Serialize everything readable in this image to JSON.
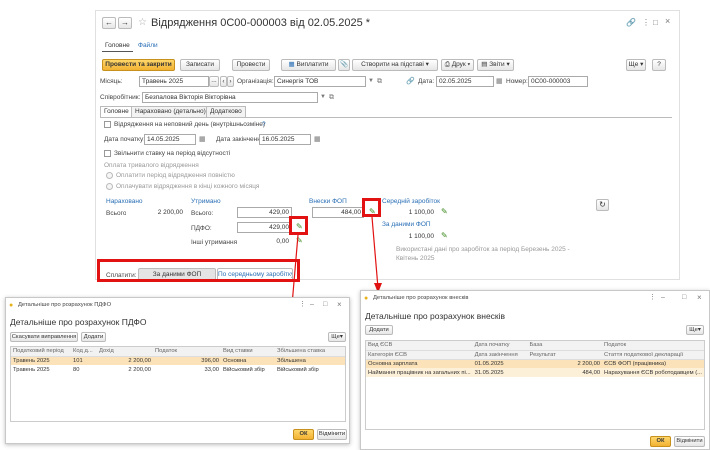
{
  "main": {
    "title": "Відрядження 0С00-000003 від 02.05.2025 *",
    "nav_tabs": [
      "Головне",
      "Файли"
    ],
    "toolbar": {
      "post_close": "Провести та закрити",
      "save": "Записати",
      "post": "Провести",
      "payments": "Виплатити",
      "create_based": "Створити на підставі",
      "print": "Друк",
      "reports": "Звіти",
      "more": "Ще",
      "help": "?"
    },
    "month_label": "Місяць:",
    "month_value": "Травень 2025",
    "org_label": "Організація:",
    "org_value": "Синергія ТОВ",
    "date_label": "Дата:",
    "date_value": "02.05.2025",
    "number_label": "Номер:",
    "number_value": "0С00-000003",
    "employee_label": "Співробітник:",
    "employee_value": "Безпалова Вікторія Вікторівна",
    "doc_tabs": [
      "Головне",
      "Нараховано (детально)",
      "Додатково"
    ],
    "partial_day": "Відрядження на неповний день (внутрішньозміне)",
    "partial_help": "?",
    "start_label": "Дата початку:",
    "start_value": "14.05.2025",
    "end_label": "Дата закінчення:",
    "end_value": "16.05.2025",
    "free_rate": "Звільнити ставку на період відсутності",
    "long_trip": "Оплата тривалого відрядження",
    "opt1": "Оплатити період відрядження повністю",
    "opt2": "Оплачувати відрядження в кінці кожного місяця",
    "accrued_h": "Нараховано",
    "withheld_h": "Утримано",
    "contrib_h": "Внески ФОП",
    "avg_h": "Середній заробіток",
    "total_label1": "Всього:",
    "total_accrued": "2 200,00",
    "total_label2": "Всього:",
    "total_withheld": "429,00",
    "contrib_value": "484,00",
    "avg_value": "1 100,00",
    "pdfo_label": "ПДФО:",
    "pdfo_value": "429,00",
    "other_label": "Інші утримання:",
    "other_value": "0,00",
    "fop_link": "За даними ФОП",
    "fop_value": "1 100,00",
    "used_note": "Використані дані про заробіток за період Березень 2025 - Квітень 2025",
    "pay_label": "Сплатити:",
    "pay_fop": "За даними ФОП",
    "pay_avg": "По середньому заробітку"
  },
  "pdfo_dialog": {
    "window_title": "Детальніше про розрахунок ПДФО",
    "heading": "Детальніше про розрахунок ПДФО",
    "cancel_fix": "Скасувати виправлення",
    "add": "Додати",
    "more": "Ще",
    "columns": [
      "Податковий період",
      "Код д...",
      "Дохід",
      "Податок",
      "Вид ставки",
      "Збільшена ставка"
    ],
    "rows": [
      [
        "Травень 2025",
        "101",
        "2 200,00",
        "396,00",
        "Основна",
        "Збільшена"
      ],
      [
        "Травень 2025",
        "80",
        "2 200,00",
        "33,00",
        "Військовий збір",
        "Військовий збір"
      ]
    ],
    "ok": "ОК",
    "cancel": "Відмінити"
  },
  "contrib_dialog": {
    "window_title": "Детальніше про розрахунок внесків",
    "heading": "Детальніше про розрахунок внесків",
    "add": "Додати",
    "more": "Ще",
    "columns1": [
      "Вид ЄСВ",
      "Дата початку",
      "База",
      "Податок"
    ],
    "columns2": [
      "Категорія ЄСВ",
      "Дата закінчення",
      "Результат",
      "Стаття податкової декларації"
    ],
    "rows": [
      [
        "Основна зарплата",
        "01.05.2025",
        "2 200,00",
        "ЄСВ ФОП (працівника)"
      ],
      [
        "Наймання працівник на загальних пі...",
        "31.05.2025",
        "484,00",
        "Нарахування ЄСВ роботодавцем (..."
      ]
    ],
    "ok": "ОК",
    "cancel": "Відмінити"
  },
  "colors": {
    "accent": "#f2b233",
    "link": "#2a6fb5",
    "highlight": "#e21212",
    "pencil": "#3a8a1e"
  }
}
